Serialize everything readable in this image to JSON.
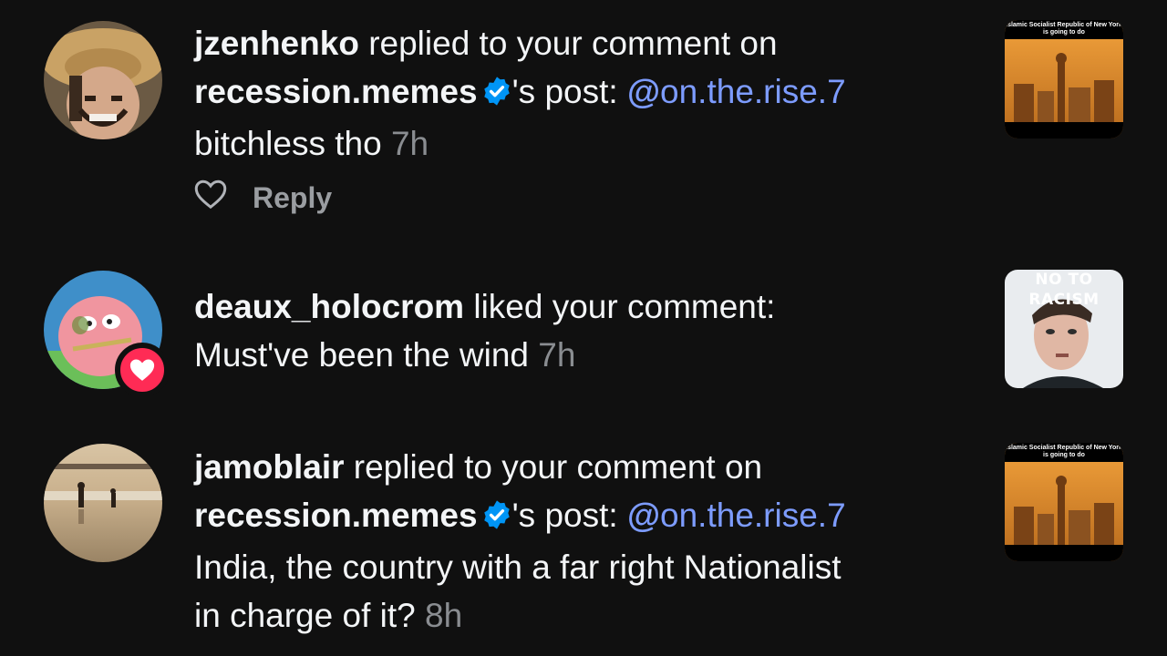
{
  "notifications": [
    {
      "username": "jzenhenko",
      "action": " replied to your comment on",
      "post_owner": "recession.memes",
      "post_suffix": "'s post: ",
      "mention": "on.the.rise.7",
      "text": "bitchless tho",
      "time": "7h",
      "reply_label": "Reply",
      "thumb_caption": "Islamic Socialist Republic of New York is going to do"
    },
    {
      "username": "deaux_holocrom",
      "action": " liked your comment:",
      "text": "Must've been the wind",
      "time": "7h",
      "thumb_caption": "NO TO RACISM"
    },
    {
      "username": "jamoblair",
      "action": " replied to your comment on",
      "post_owner": "recession.memes",
      "post_suffix": "'s post: ",
      "mention": "on.the.rise.7",
      "text_line1": "India, the country with a far right Nationalist",
      "text_line2": "in charge of it?",
      "time": "8h",
      "thumb_caption": "Islamic Socialist Republic of New York is going to do"
    }
  ],
  "colors": {
    "background": "#101010",
    "mention": "#7d9cff",
    "verified": "#0095f6",
    "like_badge": "#ff2b55",
    "muted": "#8a8d91"
  },
  "icons": [
    "verified-badge-icon",
    "threads-logo-icon",
    "heart-icon",
    "heart-filled-icon"
  ]
}
